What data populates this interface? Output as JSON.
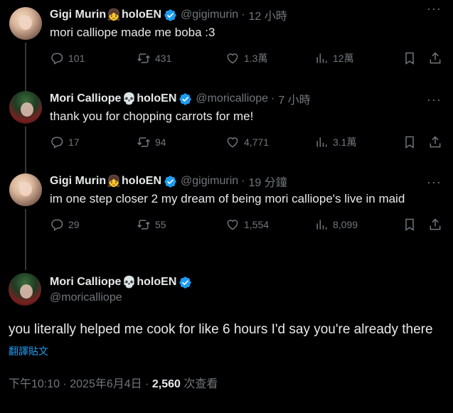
{
  "tweets": [
    {
      "name": "Gigi Murin",
      "emoji": "👧",
      "suffix": "holoEN",
      "handle": "@gigimurin",
      "sep": "·",
      "time": "12 小時",
      "text": "mori calliope made me boba :3",
      "replies": "101",
      "retweets": "431",
      "likes": "1.3萬",
      "views": "12萬"
    },
    {
      "name": "Mori Calliope",
      "emoji": "💀",
      "suffix": "holoEN",
      "handle": "@moricalliope",
      "sep": "·",
      "time": "7 小時",
      "text": "thank you for chopping carrots for me!",
      "replies": "17",
      "retweets": "94",
      "likes": "4,771",
      "views": "3.1萬"
    },
    {
      "name": "Gigi Murin",
      "emoji": "👧",
      "suffix": "holoEN",
      "handle": "@gigimurin",
      "sep": "·",
      "time": "19 分鐘",
      "text": "im one step closer 2 my dream of being mori calliope's live in maid",
      "replies": "29",
      "retweets": "55",
      "likes": "1,554",
      "views": "8,099"
    }
  ],
  "main": {
    "name": "Mori Calliope",
    "emoji": "💀",
    "suffix": "holoEN",
    "handle": "@moricalliope",
    "text": "you literally helped me cook for like 6 hours I'd say you're already there",
    "translate": "翻譯貼文",
    "timestamp": "下午10:10 · 2025年6月4日 · ",
    "views_count": "2,560",
    "views_label": " 次查看"
  },
  "colors": {
    "background": "#000000",
    "text": "#e7e9ea",
    "muted": "#71767b",
    "accent": "#1d9bf0"
  },
  "icons": [
    "more-icon",
    "reply-icon",
    "retweet-icon",
    "like-icon",
    "views-icon",
    "bookmark-icon",
    "share-icon",
    "verified-icon"
  ]
}
